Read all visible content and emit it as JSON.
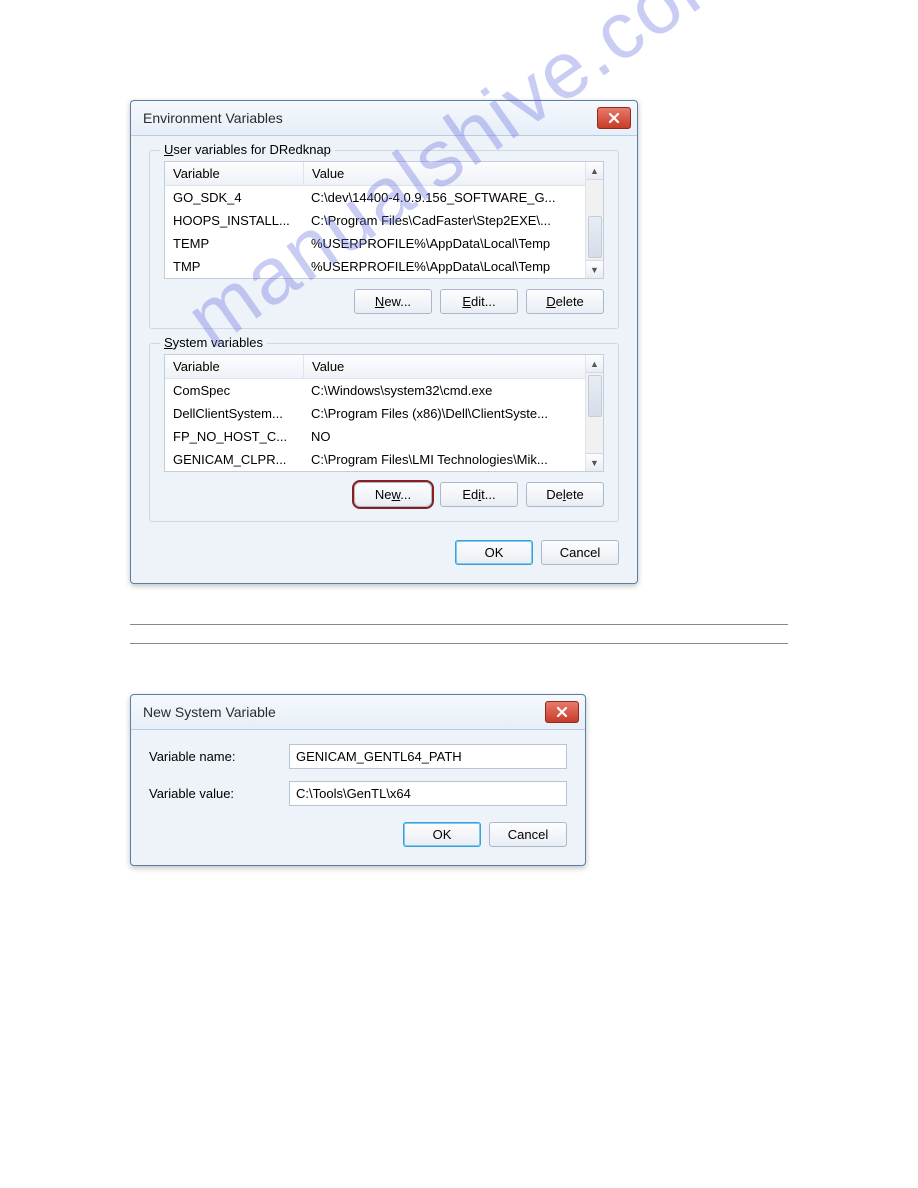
{
  "watermark": "manualshive.com",
  "envDialog": {
    "title": "Environment Variables",
    "userGroupLabelPrefix": "U",
    "userGroupLabelRest": "ser variables for DRedknap",
    "sysGroupLabelPrefix": "S",
    "sysGroupLabelRest": "ystem variables",
    "colHeader1": "Variable",
    "colHeader2": "Value",
    "userVars": [
      {
        "name": "GO_SDK_4",
        "value": "C:\\dev\\14400-4.0.9.156_SOFTWARE_G..."
      },
      {
        "name": "HOOPS_INSTALL...",
        "value": "C:\\Program Files\\CadFaster\\Step2EXE\\..."
      },
      {
        "name": "TEMP",
        "value": "%USERPROFILE%\\AppData\\Local\\Temp"
      },
      {
        "name": "TMP",
        "value": "%USERPROFILE%\\AppData\\Local\\Temp"
      }
    ],
    "sysVars": [
      {
        "name": "ComSpec",
        "value": "C:\\Windows\\system32\\cmd.exe"
      },
      {
        "name": "DellClientSystem...",
        "value": "C:\\Program Files (x86)\\Dell\\ClientSyste..."
      },
      {
        "name": "FP_NO_HOST_C...",
        "value": "NO"
      },
      {
        "name": "GENICAM_CLPR...",
        "value": "C:\\Program Files\\LMI Technologies\\Mik..."
      }
    ],
    "buttons": {
      "newU": "N",
      "newRest": "ew...",
      "editU": "E",
      "editRest": "dit...",
      "deleteU": "D",
      "deleteRest": "elete",
      "new2U": "w",
      "new2Pre": "Ne",
      "new2Post": "...",
      "edit2U": "i",
      "edit2Pre": "Ed",
      "edit2Post": "t...",
      "delete2U": "l",
      "delete2Pre": "De",
      "delete2Post": "ete",
      "ok": "OK",
      "cancel": "Cancel"
    }
  },
  "newVarDialog": {
    "title": "New System Variable",
    "nameLabel": "Variable name:",
    "valueLabel": "Variable value:",
    "nameValue": "GENICAM_GENTL64_PATH",
    "valueValue": "C:\\Tools\\GenTL\\x64",
    "ok": "OK",
    "cancel": "Cancel"
  }
}
